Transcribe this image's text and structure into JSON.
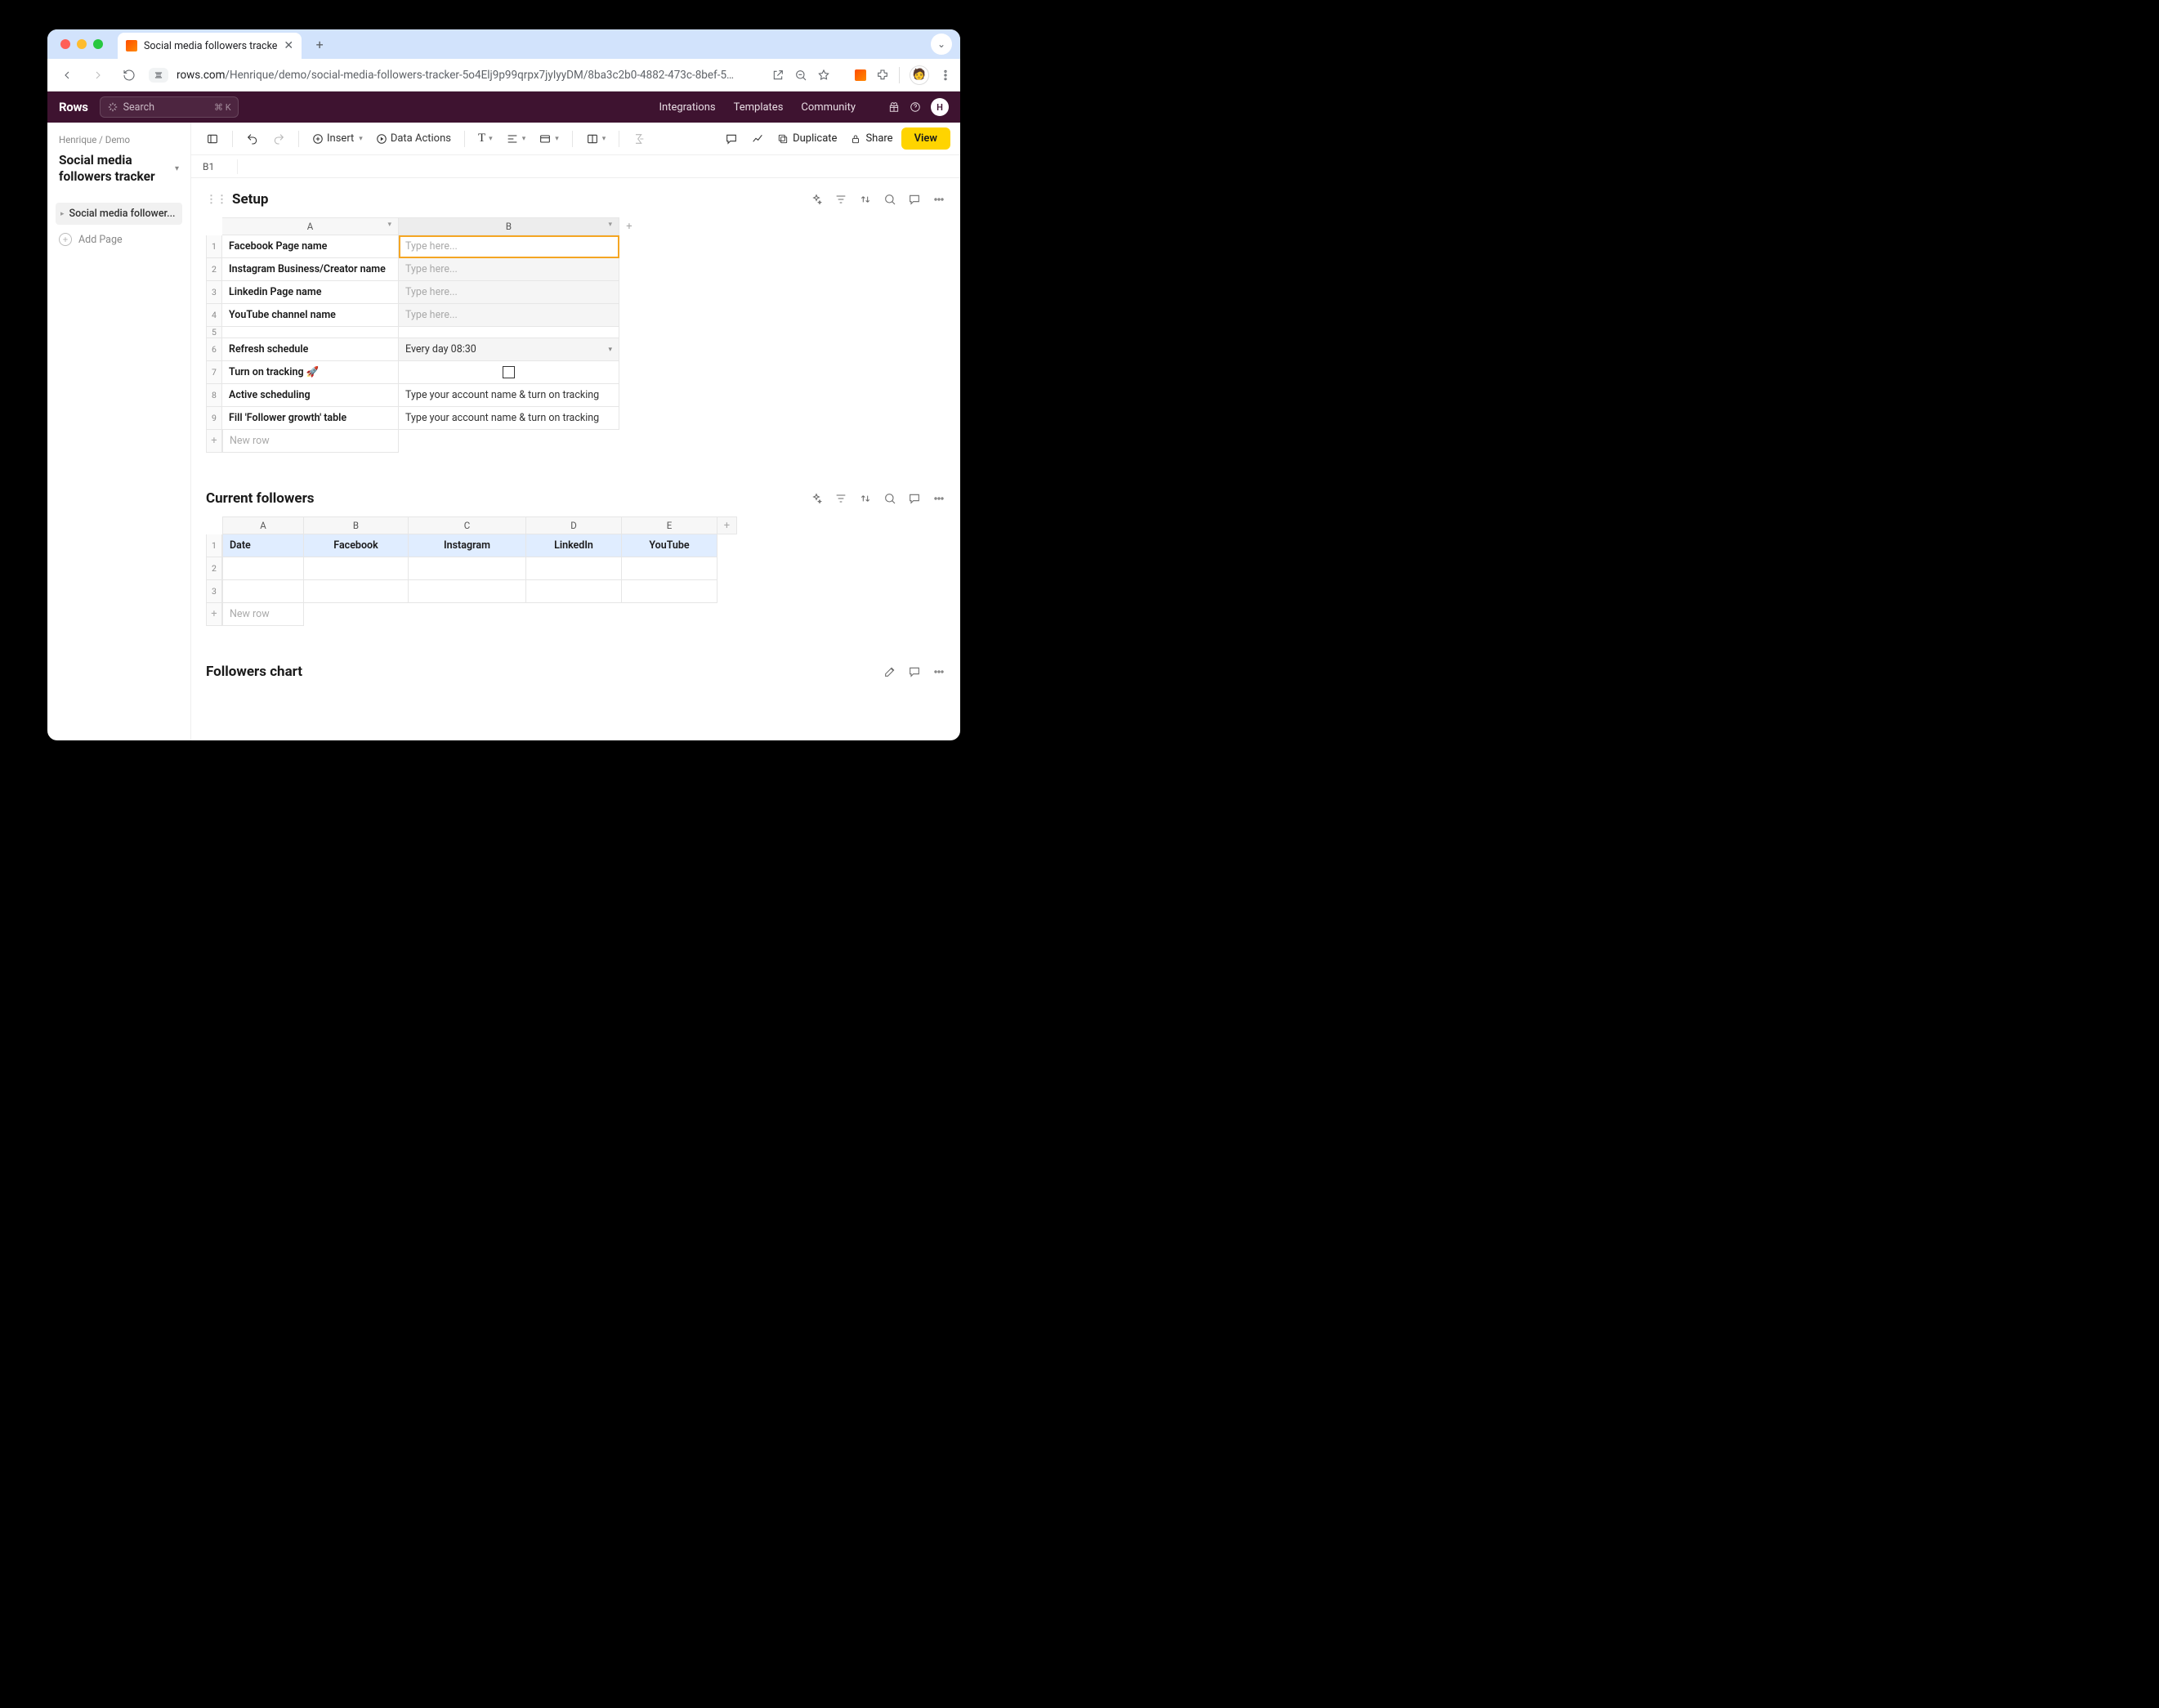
{
  "browser": {
    "tab_title": "Social media followers tracke",
    "url_host": "rows.com",
    "url_path": "/Henrique/demo/social-media-followers-tracker-5o4Elj9p99qrpx7jyIyyDM/8ba3c2b0-4882-473c-8bef-5…"
  },
  "app": {
    "logo": "Rows",
    "search_placeholder": "Search",
    "search_kbd": "⌘ K",
    "nav": {
      "integrations": "Integrations",
      "templates": "Templates",
      "community": "Community"
    },
    "user_initial": "H"
  },
  "sidebar": {
    "crumb1": "Henrique",
    "crumb2": "Demo",
    "doc_title": "Social media followers tracker",
    "page1": "Social media follower...",
    "add_page": "Add Page"
  },
  "toolbar": {
    "insert": "Insert",
    "data_actions": "Data Actions",
    "duplicate": "Duplicate",
    "share": "Share",
    "view": "View"
  },
  "cellref": "B1",
  "setup": {
    "title": "Setup",
    "colA": "A",
    "colB": "B",
    "rows": {
      "r1a": "Facebook Page name",
      "r2a": "Instagram Business/Creator name",
      "r3a": "Linkedin Page name",
      "r4a": "YouTube channel name",
      "r6a": "Refresh schedule",
      "r6b": "Every day 08:30",
      "r7a": "Turn on tracking 🚀",
      "r8a": "Active scheduling",
      "r8b": "Type your account name & turn on tracking",
      "r9a": "Fill 'Follower growth' table",
      "r9b": "Type your account name & turn on tracking",
      "placeholder": "Type here...",
      "newrow": "New row"
    }
  },
  "followers": {
    "title": "Current followers",
    "cols": {
      "A": "A",
      "B": "B",
      "C": "C",
      "D": "D",
      "E": "E"
    },
    "headers": {
      "date": "Date",
      "fb": "Facebook",
      "ig": "Instagram",
      "li": "LinkedIn",
      "yt": "YouTube"
    },
    "newrow": "New row"
  },
  "chart": {
    "title": "Followers chart"
  }
}
